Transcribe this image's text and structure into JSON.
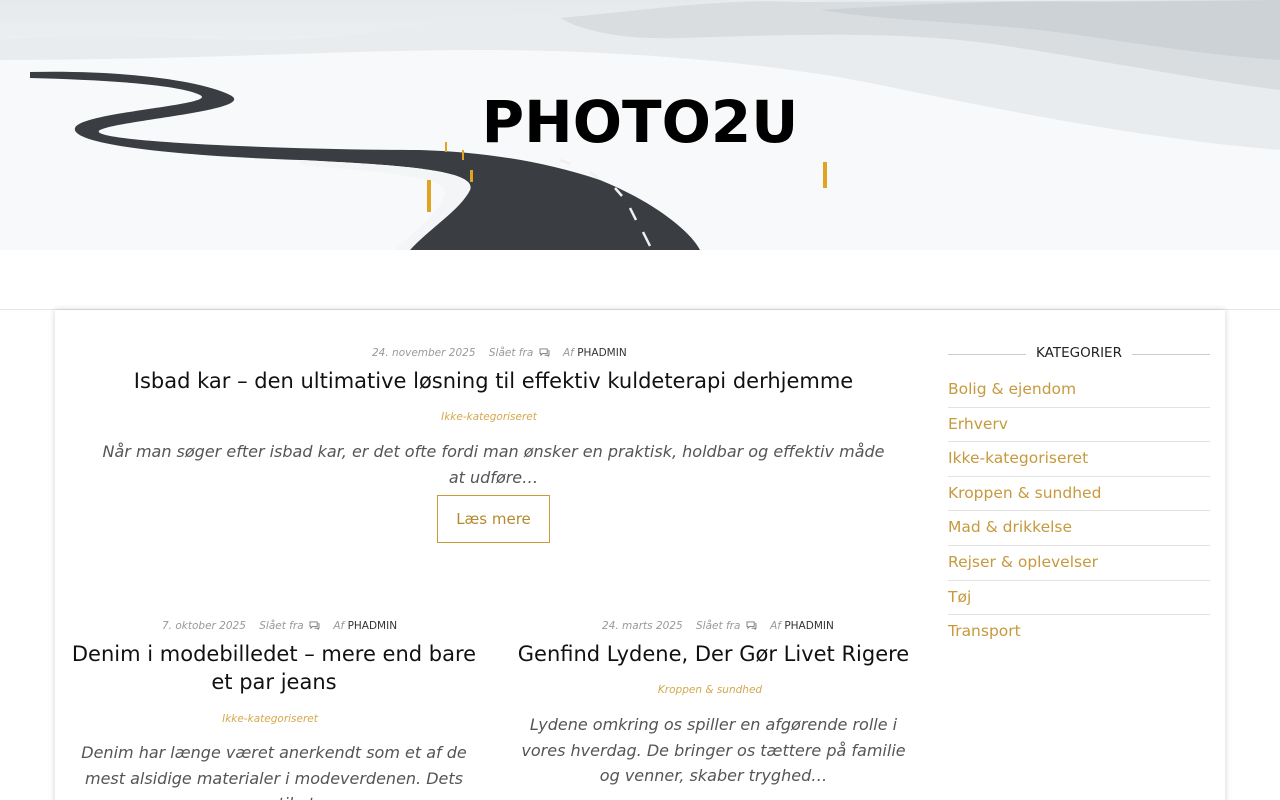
{
  "site": {
    "title": "PHOTO2U"
  },
  "posts": [
    {
      "date": "24. november 2025",
      "comments": "Slået fra",
      "author_prefix": "Af",
      "author": "PHADMIN",
      "title": "Isbad kar – den ultimative løsning til effektiv kuldeterapi derhjemme",
      "category": "Ikke-kategoriseret",
      "excerpt": "Når man søger efter isbad kar, er det ofte fordi man ønsker en praktisk, holdbar og effektiv måde at udføre…",
      "read_more": "Læs mere"
    },
    {
      "date": "7. oktober 2025",
      "comments": "Slået fra",
      "author_prefix": "Af",
      "author": "PHADMIN",
      "title": "Denim i modebilledet – mere end bare et par jeans",
      "category": "Ikke-kategoriseret",
      "excerpt": "Denim har længe været anerkendt som et af de mest alsidige materialer i modeverdenen. Dets evne til at"
    },
    {
      "date": "24. marts 2025",
      "comments": "Slået fra",
      "author_prefix": "Af",
      "author": "PHADMIN",
      "title": "Genfind Lydene, Der Gør Livet Rigere",
      "category": "Kroppen & sundhed",
      "excerpt": "Lydene omkring os spiller en afgørende rolle i vores hverdag. De bringer os tættere på familie og venner, skaber tryghed…"
    }
  ],
  "sidebar": {
    "categories_title": "KATEGORIER",
    "categories": [
      "Bolig & ejendom",
      "Erhverv",
      "Ikke-kategoriseret",
      "Kroppen & sundhed",
      "Mad & drikkelse",
      "Rejser & oplevelser",
      "Tøj",
      "Transport"
    ]
  },
  "colors": {
    "accent": "#c69a3d",
    "category": "#d4a84e"
  },
  "icons": {
    "comments": "comments-icon"
  }
}
